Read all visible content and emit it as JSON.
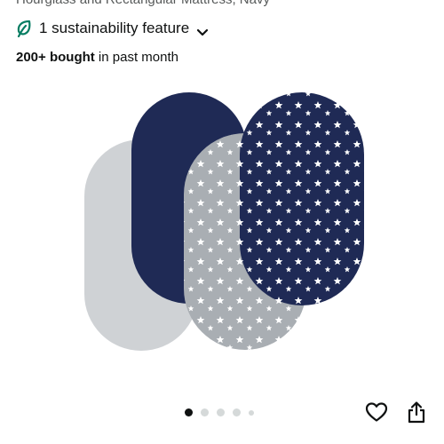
{
  "product": {
    "title_partial": "Hourglass and Rectangular Mattress, Navy",
    "sustainability_label": "1 sustainability feature",
    "bought_count": "200+ bought",
    "bought_suffix": " in past month",
    "image_alt": "Four oval fitted sheets: grey, navy, grey with white stars, navy with white stars"
  },
  "carousel": {
    "total_images": 5,
    "active_index": 0
  },
  "colors": {
    "navy": "#1f2a55",
    "light_grey": "#cfd2d5",
    "star_grey": "#a9aeb3",
    "leaf_green": "#067d62"
  },
  "icons": {
    "sustainability": "leaf-icon",
    "expand": "chevron-down-icon",
    "wishlist": "heart-icon",
    "share": "share-icon"
  }
}
